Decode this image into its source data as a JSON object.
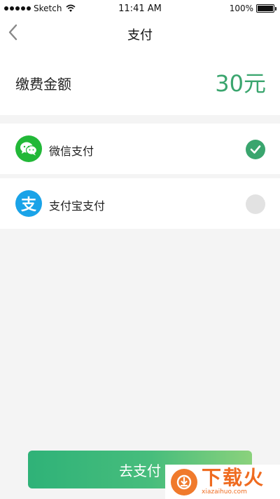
{
  "status_bar": {
    "carrier": "Sketch",
    "time": "11:41 AM",
    "battery": "100%"
  },
  "nav": {
    "title": "支付"
  },
  "amount": {
    "label": "缴费金额",
    "value": "30元"
  },
  "payment_methods": [
    {
      "label": "微信支付",
      "icon": "wechat-icon",
      "selected": true
    },
    {
      "label": "支付宝支付",
      "icon": "alipay-icon",
      "icon_glyph": "支",
      "selected": false
    }
  ],
  "pay_button": {
    "label": "去支付"
  },
  "watermark": {
    "text_cn": "下载火",
    "text_en": "xiazaihuo.com"
  },
  "colors": {
    "accent": "#3aa56e",
    "wechat": "#22b838",
    "alipay": "#1aa3e8"
  }
}
